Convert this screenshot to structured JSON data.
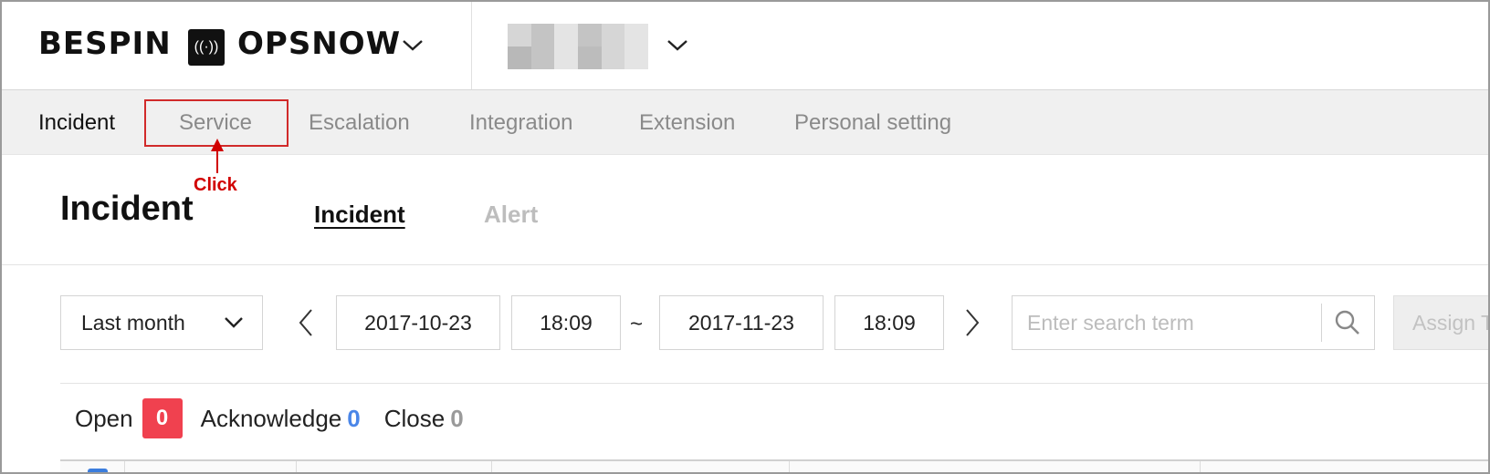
{
  "header": {
    "brand": "BESPIN",
    "product": "OPSNOW",
    "colors": {
      "nav_bg": "#f0f0f0",
      "highlight": "#d12a2a",
      "open_badge": "#f0414f",
      "acknowledge": "#4a86e8"
    }
  },
  "nav": {
    "items": [
      {
        "label": "Incident",
        "active": true
      },
      {
        "label": "Service",
        "active": false
      },
      {
        "label": "Escalation",
        "active": false
      },
      {
        "label": "Integration",
        "active": false
      },
      {
        "label": "Extension",
        "active": false
      },
      {
        "label": "Personal setting",
        "active": false
      }
    ],
    "annotation": "Click"
  },
  "page": {
    "title": "Incident",
    "tabs": [
      {
        "label": "Incident",
        "active": true
      },
      {
        "label": "Alert",
        "active": false
      }
    ]
  },
  "filters": {
    "range_select": "Last month",
    "start_date": "2017-10-23",
    "start_time": "18:09",
    "separator": "~",
    "end_date": "2017-11-23",
    "end_time": "18:09",
    "search_placeholder": "Enter search term",
    "assign_button": "Assign T"
  },
  "status": {
    "open_label": "Open",
    "open_count": "0",
    "acknowledge_label": "Acknowledge",
    "acknowledge_count": "0",
    "close_label": "Close",
    "close_count": "0"
  },
  "icons": [
    "radio-broadcast-icon",
    "chevron-down-icon",
    "chevron-left-icon",
    "chevron-right-icon",
    "search-icon",
    "arrow-up-icon"
  ]
}
